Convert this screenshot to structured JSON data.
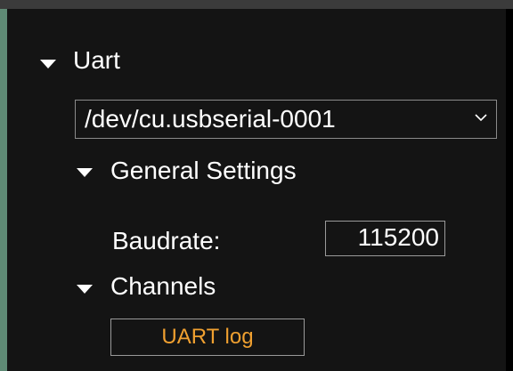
{
  "uart": {
    "section_label": "Uart",
    "port_select": {
      "selected_value": "/dev/cu.usbserial-0001",
      "chevron_icon": "chevron-down-icon"
    },
    "general_settings": {
      "label": "General Settings",
      "baudrate_label": "Baudrate:",
      "baudrate_value": "115200"
    },
    "channels": {
      "label": "Channels",
      "items": [
        {
          "label": "UART log"
        }
      ]
    }
  },
  "colors": {
    "background": "#141414",
    "accent_bar": "#5f8a75",
    "channel_text": "#f0a030",
    "border": "#9a9a9a"
  }
}
